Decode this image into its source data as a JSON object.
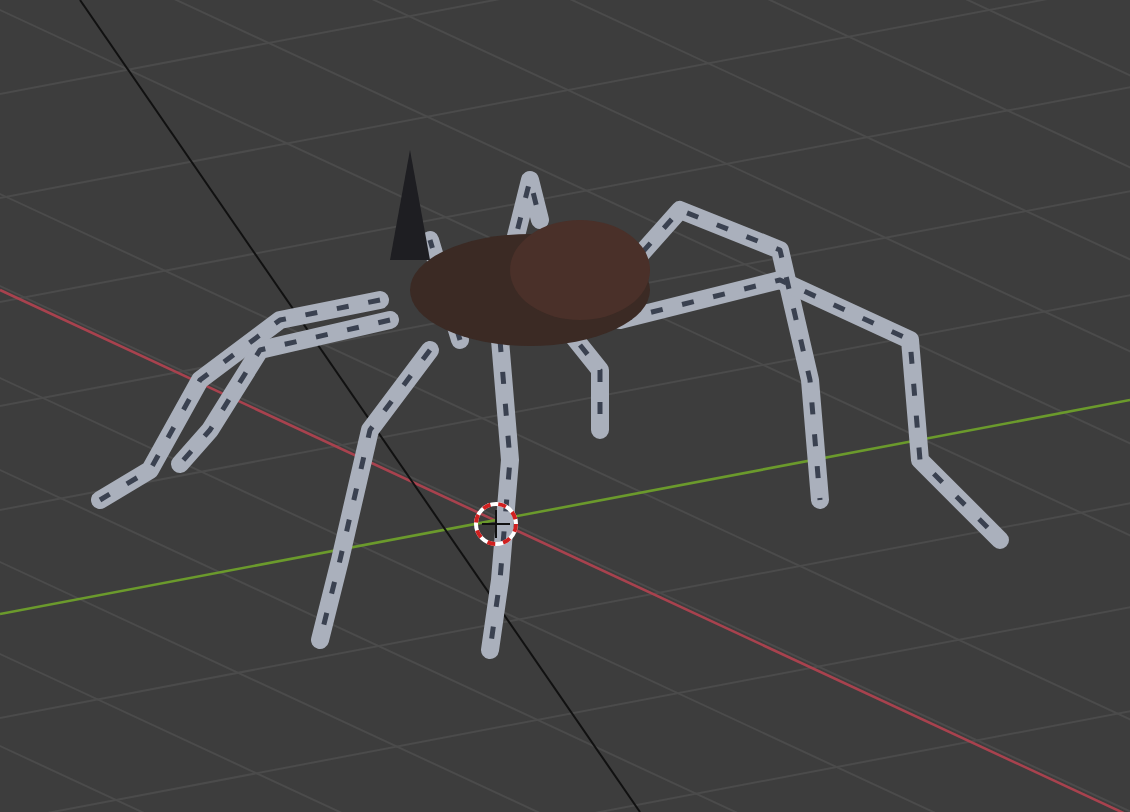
{
  "viewport": {
    "axes": [
      {
        "kind": "x",
        "color": "#a8424e"
      },
      {
        "kind": "y",
        "color": "#6b9a2c"
      }
    ],
    "cursor_visible": true
  }
}
